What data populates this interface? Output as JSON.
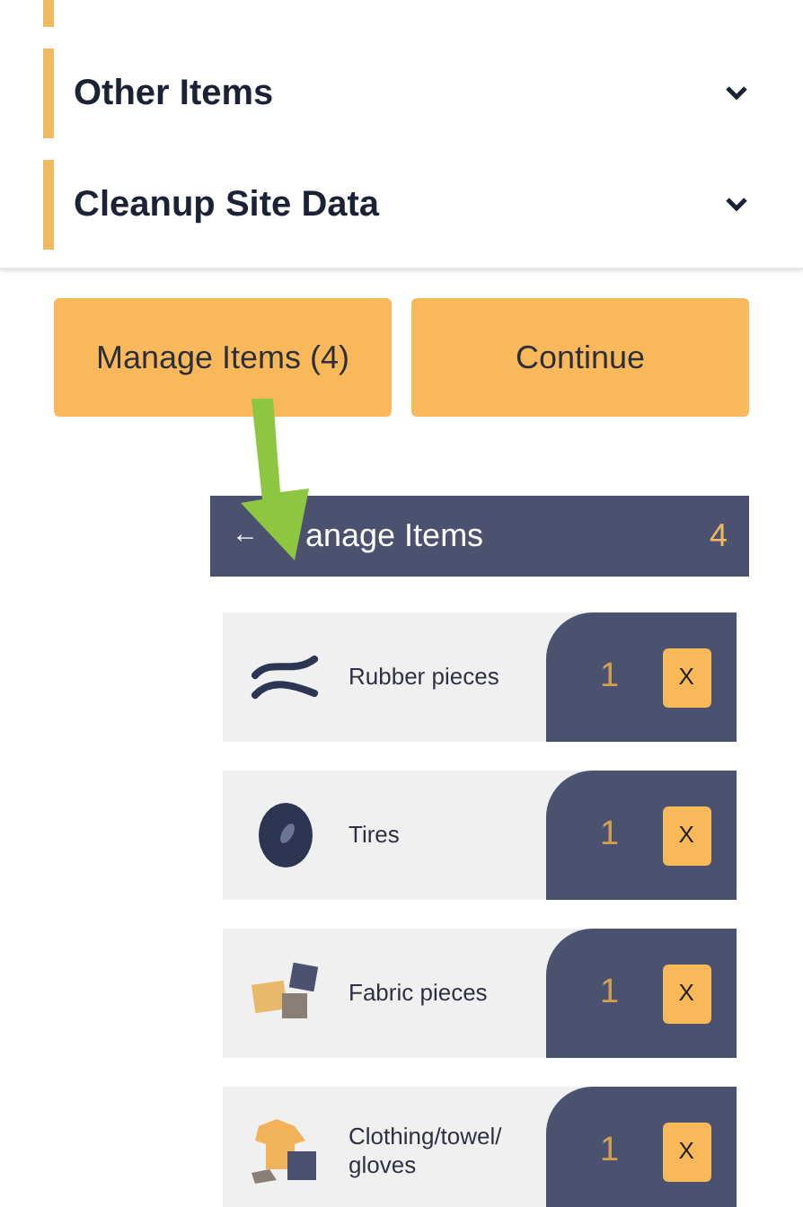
{
  "sections": [
    {
      "kind": "partial"
    },
    {
      "kind": "collapsible",
      "label": "Other Items"
    },
    {
      "kind": "collapsible",
      "label": "Cleanup Site Data"
    }
  ],
  "buttons": [
    {
      "label": "Manage Items (4)"
    },
    {
      "label": "Continue"
    }
  ],
  "manage_items": {
    "back": "←",
    "title": "anage Items",
    "count": "4",
    "items": [
      {
        "kind": "rubber",
        "name": "Rubber pieces",
        "quantity": "1",
        "remove": "X"
      },
      {
        "kind": "tire",
        "name": "Tires",
        "quantity": "1",
        "remove": "X"
      },
      {
        "kind": "fabric",
        "name": "Fabric pieces",
        "quantity": "1",
        "remove": "X"
      },
      {
        "kind": "clothing",
        "name": "Clothing/towel/ gloves",
        "quantity": "1",
        "remove": "X"
      }
    ]
  }
}
